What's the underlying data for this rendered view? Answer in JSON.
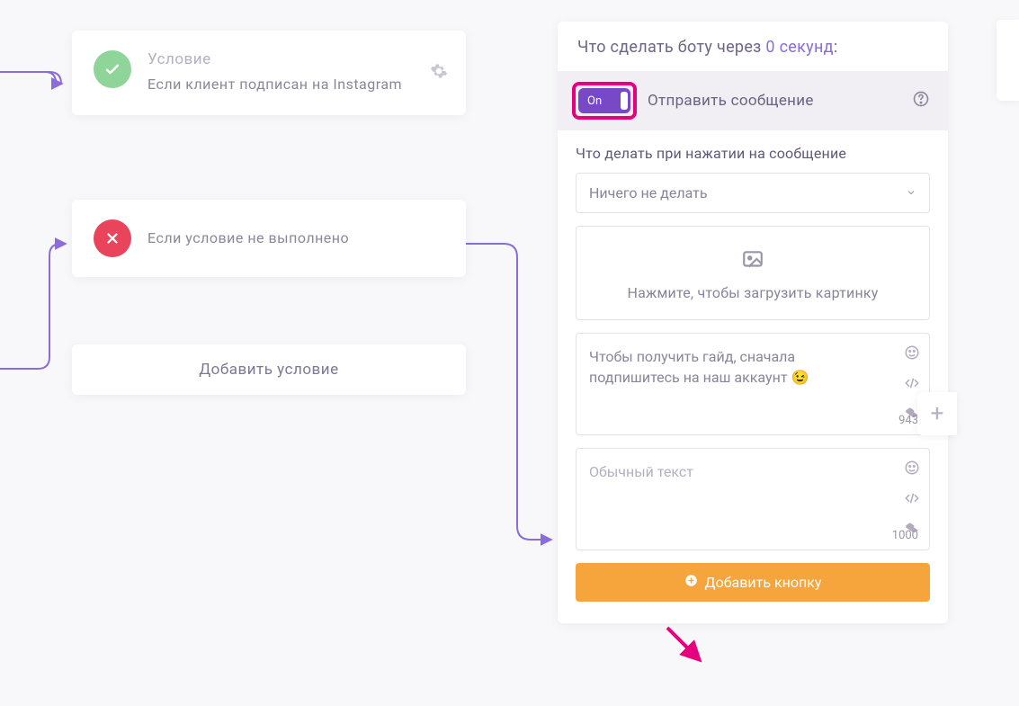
{
  "conditions": {
    "card1": {
      "title": "Условие",
      "desc": "Если клиент подписан на Instagram"
    },
    "card2": {
      "desc": "Если условие не выполнено"
    },
    "add_label": "Добавить условие"
  },
  "panel": {
    "header_prefix": "Что сделать боту через ",
    "header_delay": "0 секунд",
    "header_suffix": ":",
    "toggle_label": "On",
    "action_label": "Отправить сообщение",
    "tap_label": "Что делать при нажатии на сообщение",
    "tap_select": "Ничего не делать",
    "upload_label": "Нажмите, чтобы загрузить картинку",
    "msg1_text": "Чтобы получить гайд, сначала подпишитесь на наш аккаунт 😉",
    "msg1_count": "943",
    "msg2_placeholder": "Обычный текст",
    "msg2_count": "1000",
    "add_button": "Добавить кнопку"
  }
}
